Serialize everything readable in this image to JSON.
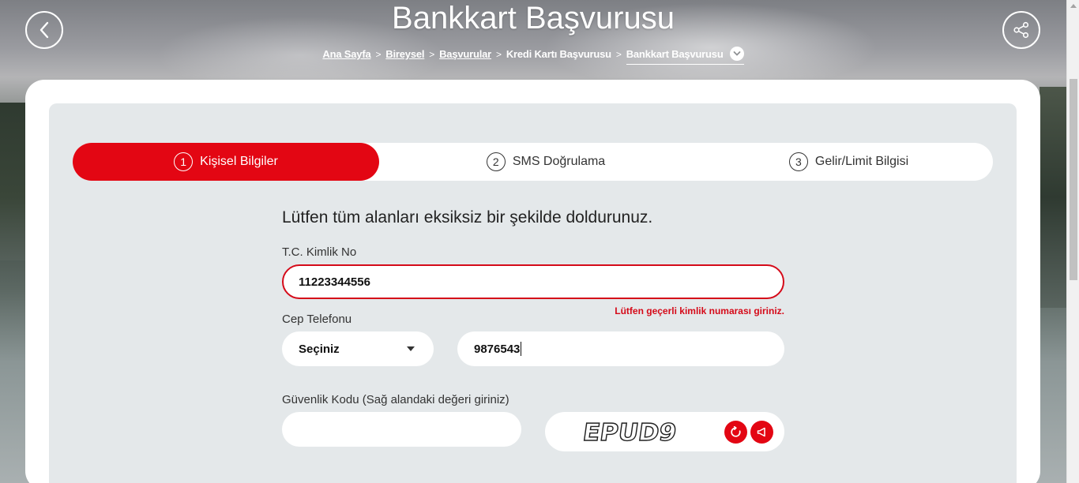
{
  "header": {
    "title": "Bankkart Başvurusu",
    "back_icon": "chevron-left-icon",
    "share_icon": "share-icon"
  },
  "breadcrumb": {
    "items": [
      "Ana Sayfa",
      "Bireysel",
      "Başvurular",
      "Kredi Kartı Başvurusu",
      "Bankkart Başvurusu"
    ]
  },
  "stepper": {
    "steps": [
      {
        "number": "1",
        "label": "Kişisel Bilgiler",
        "active": true
      },
      {
        "number": "2",
        "label": "SMS Doğrulama",
        "active": false
      },
      {
        "number": "3",
        "label": "Gelir/Limit Bilgisi",
        "active": false
      }
    ]
  },
  "form": {
    "intro": "Lütfen tüm alanları eksiksiz bir şekilde doldurunuz.",
    "tc_label": "T.C. Kimlik No",
    "tc_value": "11223344556",
    "tc_error": "Lütfen geçerli kimlik numarası giriniz.",
    "phone_label": "Cep Telefonu",
    "phone_prefix_value": "Seçiniz",
    "phone_value": "9876543",
    "security_label": "Güvenlik Kodu (Sağ alandaki değeri giriniz)",
    "security_value": "",
    "captcha_text": "EPUD9"
  },
  "colors": {
    "accent": "#e30613",
    "error": "#d50a19",
    "panel": "#e4e8ea"
  }
}
